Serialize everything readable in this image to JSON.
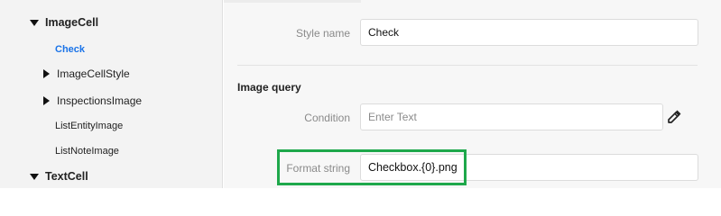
{
  "tree": {
    "items": [
      {
        "label": "ImageCell",
        "expanded": true
      },
      {
        "label": "Check",
        "selected": true
      },
      {
        "label": "ImageCellStyle",
        "expanded": false
      },
      {
        "label": "InspectionsImage",
        "expanded": false
      },
      {
        "label": "ListEntityImage"
      },
      {
        "label": "ListNoteImage"
      },
      {
        "label": "TextCell",
        "expanded": true
      }
    ]
  },
  "form": {
    "style_name": {
      "label": "Style name",
      "value": "Check"
    },
    "section_title": "Image query",
    "condition": {
      "label": "Condition",
      "placeholder": "Enter Text",
      "value": ""
    },
    "format_string": {
      "label": "Format string",
      "value": "Checkbox.{0}.png"
    }
  },
  "colors": {
    "selected_item": "#1a73e8",
    "highlight_border": "#1ea84b"
  },
  "icons": {
    "edit": "pencil-icon"
  }
}
